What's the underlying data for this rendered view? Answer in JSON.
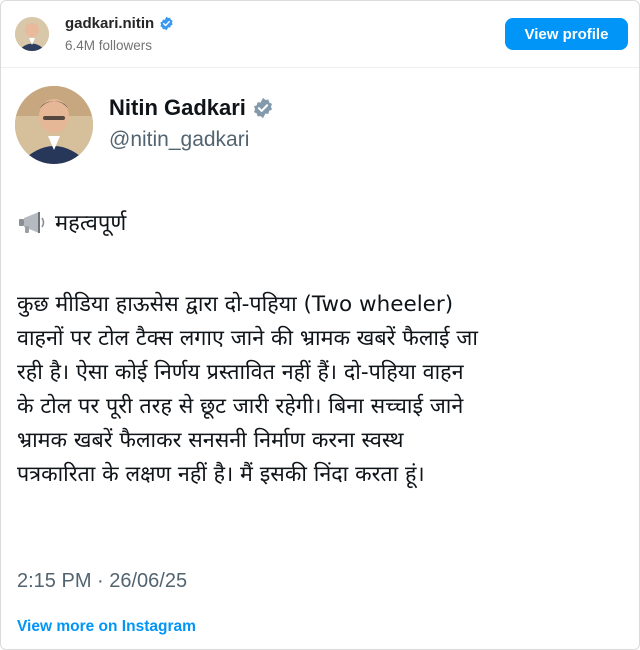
{
  "instagram": {
    "username": "gadkari.nitin",
    "followers": "6.4M followers",
    "view_profile_label": "View profile",
    "view_more_label": "View more on Instagram"
  },
  "tweet": {
    "name": "Nitin Gadkari",
    "handle": "@nitin_gadkari",
    "heading": "महत्वपूर्ण",
    "body_lines": [
      "कुछ मीडिया हाऊसेस  द्वारा दो-पहिया (Two wheeler)",
      "वाहनों पर टोल टैक्स लगाए जाने की भ्रामक खबरें फैलाई जा",
      "रही है। ऐसा कोई निर्णय प्रस्तावित नहीं हैं। दो-पहिया वाहन",
      "के टोल पर पूरी तरह से छूट जारी रहेगी। बिना सच्चाई जाने",
      "भ्रामक खबरें फैलाकर सनसनी निर्माण करना स्वस्थ",
      "पत्रकारिता के लक्षण नहीं है। मैं इसकी निंदा करता हूं।"
    ],
    "timestamp": "2:15 PM · 26/06/25"
  },
  "colors": {
    "instagram_blue": "#0095f6",
    "verified_blue": "#3897f0",
    "verified_gray": "#829aab",
    "secondary_text": "#536471"
  },
  "icons": [
    "verified-badge-icon",
    "megaphone-icon"
  ]
}
